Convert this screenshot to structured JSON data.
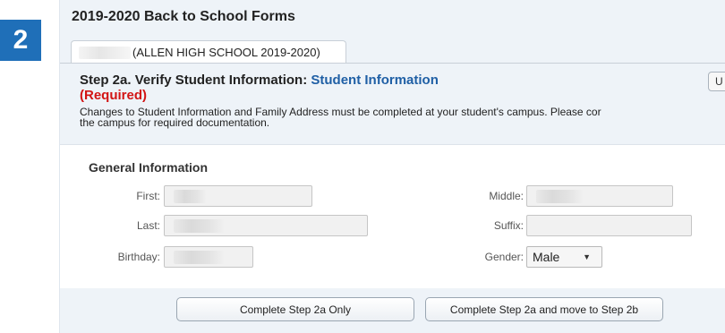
{
  "step_badge": "2",
  "form_title": "2019-2020 Back to School Forms",
  "tab": {
    "label": "(ALLEN HIGH SCHOOL 2019-2020)"
  },
  "step": {
    "title_prefix": "Step 2a. Verify Student Information:",
    "section_name": "Student Information",
    "required": "(Required)",
    "corner_button_label": "U",
    "notice_line1": "Changes to Student Information and Family Address must be completed at your student's campus. Please cor",
    "notice_line2": "the campus for required documentation."
  },
  "general_info": {
    "heading": "General Information",
    "first_label": "First:",
    "middle_label": "Middle:",
    "last_label": "Last:",
    "suffix_label": "Suffix:",
    "birthday_label": "Birthday:",
    "gender_label": "Gender:",
    "gender_value": "Male"
  },
  "buttons": {
    "step2a_only": "Complete Step 2a Only",
    "step2a_to_2b": "Complete Step 2a and move to Step 2b"
  },
  "colors": {
    "badge": "#1f6fb8",
    "section_link": "#1f5fa5",
    "required": "#d21414",
    "panel_bg": "#eef3f8"
  }
}
